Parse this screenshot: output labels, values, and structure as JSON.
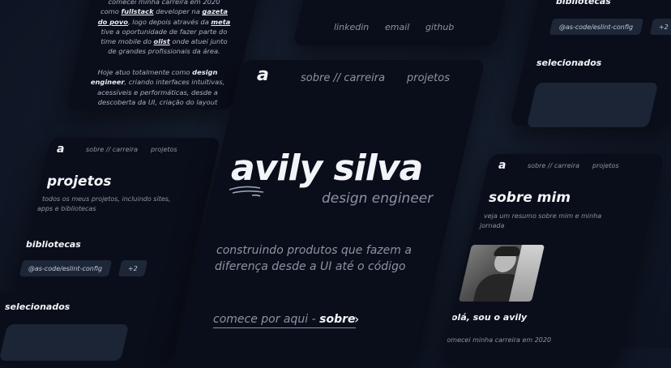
{
  "brand": {
    "logo": "a"
  },
  "nav": {
    "about": "sobre // carreira",
    "projects": "projetos"
  },
  "hero": {
    "name": "avily silva",
    "role": "design engineer",
    "tagline_1": "construindo produtos que fazem  a",
    "tagline_2": "diferença desde a UI até o código",
    "cta_prefix": "comece por aqui - ",
    "cta_link": "sobre",
    "cta_arrow": "›"
  },
  "about_text": {
    "l1": "comecei minha carreira em 2020",
    "l2a": "como ",
    "l2b": "fullstack",
    "l2c": " developer na ",
    "l2d": "gazeta",
    "l3a": "do povo",
    "l3b": ", logo depois através da ",
    "l3c": "meta",
    "l4": "tive a oportunidade de fazer parte do",
    "l5a": "time mobile do ",
    "l5b": "olist",
    "l5c": " onde atuei junto",
    "l6": "de grandes profissionais da área.",
    "l7a": "Hoje atuo totalmente como ",
    "l7b": "design",
    "l8a": "engineer",
    "l8b": ", criando interfaces intuitivas,",
    "l9": "acessíveis e performáticas, desde a",
    "l10": "descoberta da UI, criação do layout"
  },
  "contact": {
    "linkedin": "linkedin",
    "email": "email",
    "github": "github"
  },
  "libraries": {
    "title": "bibliotecas",
    "chip": "@as-code/eslint-config",
    "more": "+2"
  },
  "selected": {
    "title": "selecionados"
  },
  "projects_page": {
    "title": "projetos",
    "desc_1": "todos os meus projetos, incluindo sites,",
    "desc_2": "apps e bibliotecas"
  },
  "about_page": {
    "title": "sobre mim",
    "desc_1": "veja um resumo sobre mim e minha",
    "desc_2": "jornada",
    "greeting": "olá, sou o avily",
    "career": "comecei minha carreira em 2020"
  },
  "colors": {
    "background": "#0f1626",
    "card": "#0a0e1a",
    "chip": "#1e2737",
    "text": "#c9cfdb"
  }
}
